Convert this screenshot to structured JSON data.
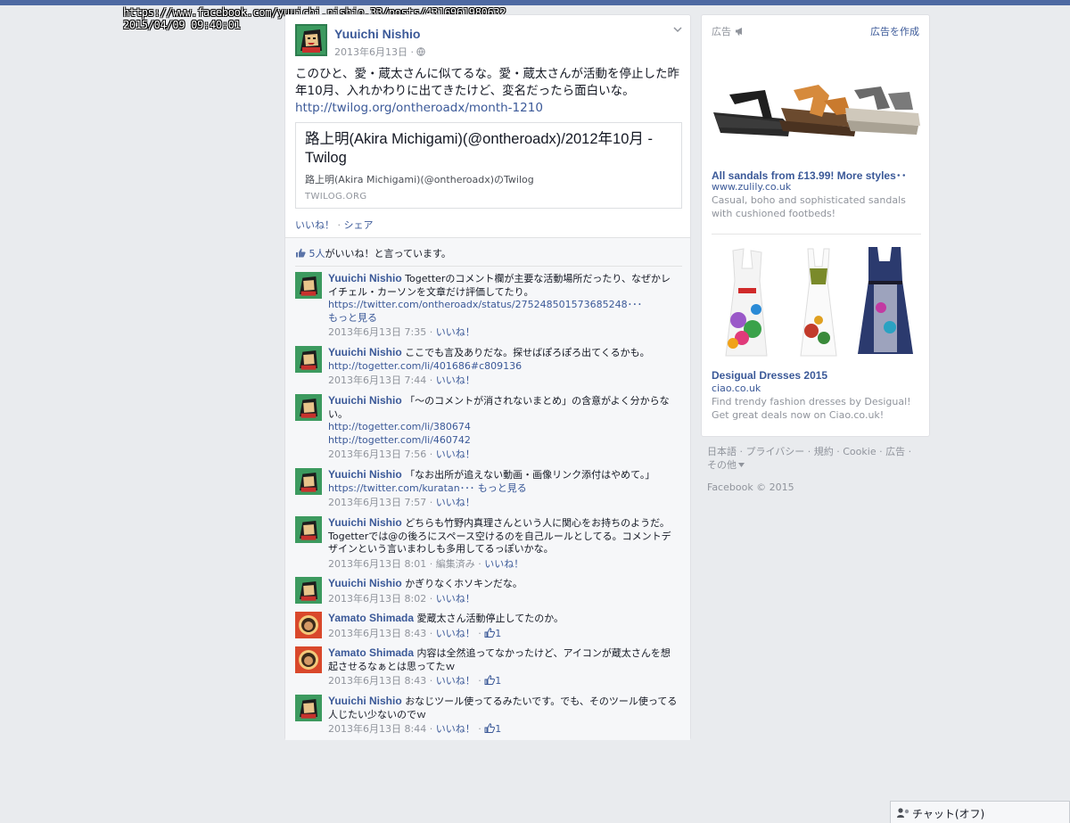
{
  "capture": {
    "url": "https://www.facebook.com/yuuichi.nishio.33/posts/4316961980632",
    "datetime": "2015/04/09  09:40:01"
  },
  "post": {
    "author": "Yuuichi Nishio",
    "date": "2013年6月13日 ·",
    "text": "このひと、愛・蔵太さんに似てるな。愛・蔵太さんが活動を停止した昨年10月、入れかわりに出てきたけど、変名だったら面白いな。",
    "link": "http://twilog.org/ontheroadx/month-1210",
    "card": {
      "title": "路上明(Akira Michigami)(@ontheroadx)/2012年10月 - Twilog",
      "desc": "路上明(Akira Michigami)(@ontheroadx)のTwilog",
      "domain": "TWILOG.ORG"
    },
    "like_label": "いいね！",
    "share_sep": " · ",
    "share_label": "シェア",
    "likes_count": "5人",
    "likes_text": "がいいね！と言っています。"
  },
  "comments": [
    {
      "name": "Yuuichi Nishio",
      "text": "Togetterのコメント欄が主要な活動場所だったり、なぜかレイチェル・カーソンを文章だけ評価してたり。",
      "link": "https://twitter.com/ontheroadx/status/275248501573685248･･･",
      "more": "もっと見る",
      "time": "2013年6月13日 7:35",
      "like": "いいね！"
    },
    {
      "name": "Yuuichi Nishio",
      "text": "ここでも言及ありだな。探せばぽろぽろ出てくるかも。",
      "link": "http://togetter.com/li/401686#c809136",
      "time": "2013年6月13日 7:44",
      "like": "いいね！"
    },
    {
      "name": "Yuuichi Nishio",
      "text": "「〜のコメントが消されないまとめ」の含意がよく分からない。",
      "link": "http://togetter.com/li/380674",
      "link2": "http://togetter.com/li/460742",
      "time": "2013年6月13日 7:56",
      "like": "いいね！"
    },
    {
      "name": "Yuuichi Nishio",
      "text": "「なお出所が追えない動画・画像リンク添付はやめて。」",
      "link": "https://twitter.com/kuratan･･･",
      "more": "もっと見る",
      "time": "2013年6月13日 7:57",
      "like": "いいね！"
    },
    {
      "name": "Yuuichi Nishio",
      "text": "どちらも竹野内真理さんという人に関心をお持ちのようだ。Togetterでは@の後ろにスペース空けるのを自己ルールとしてる。コメントデザインという言いまわしも多用してるっぽいかな。",
      "time": "2013年6月13日 8:01",
      "edited": "編集済み",
      "like": "いいね！"
    },
    {
      "name": "Yuuichi Nishio",
      "text": "かぎりなくホソキンだな。",
      "time": "2013年6月13日 8:02",
      "like": "いいね！"
    },
    {
      "name": "Yamato Shimada",
      "text": "愛蔵太さん活動停止してたのか。",
      "time": "2013年6月13日 8:43",
      "like": "いいね！",
      "likes": "1"
    },
    {
      "name": "Yamato Shimada",
      "text": "内容は全然追ってなかったけど、アイコンが蔵太さんを想起させるなぁとは思ってたｗ",
      "time": "2013年6月13日 8:43",
      "like": "いいね！",
      "likes": "1"
    },
    {
      "name": "Yuuichi Nishio",
      "text": "おなじツール使ってるみたいです。でも、そのツール使ってる人じたい少ないのでｗ",
      "time": "2013年6月13日 8:44",
      "like": "いいね！",
      "likes": "1"
    }
  ],
  "ads": {
    "header": "広告",
    "create": "広告を作成",
    "items": [
      {
        "title": "All sandals from £13.99! More styles･･",
        "url": "www.zulily.co.uk",
        "desc": "Casual, boho and sophisticated sandals with cushioned footbeds!"
      },
      {
        "title": "Desigual Dresses 2015",
        "url": "ciao.co.uk",
        "desc": "Find trendy fashion dresses by Desigual! Get great deals now on Ciao.co.uk!"
      }
    ]
  },
  "footer": {
    "links": "日本語 · プライバシー · 規約 · Cookie · 広告 · その他",
    "copyright": "Facebook © 2015"
  },
  "chat": {
    "label": "チャット(オフ)"
  },
  "colors": {
    "link": "#3b5998",
    "topbar": "#4e69a2",
    "background": "#e9ebee"
  }
}
